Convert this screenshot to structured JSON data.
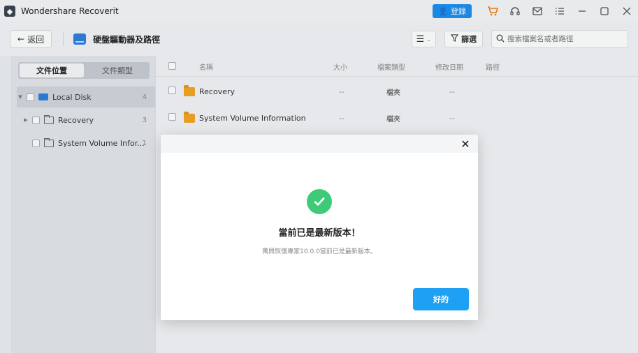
{
  "app": {
    "title": "Wondershare Recoverit"
  },
  "titlebar": {
    "login_label": "登錄"
  },
  "toolbar": {
    "back_label": "返回",
    "title": "硬盤驅動器及路徑",
    "filter_label": "篩選",
    "search_placeholder": "搜索檔案名或者路徑"
  },
  "sidebar": {
    "tabs": [
      {
        "label": "文件位置",
        "active": true
      },
      {
        "label": "文件類型",
        "active": false
      }
    ],
    "tree": [
      {
        "label": "Local Disk",
        "count": "4"
      },
      {
        "label": "Recovery",
        "count": "3"
      },
      {
        "label": "System Volume Infor...",
        "count": "1"
      }
    ]
  },
  "list": {
    "headers": {
      "name": "名稱",
      "size": "大小",
      "type": "檔案類型",
      "modified": "修改日期",
      "path": "路徑"
    },
    "rows": [
      {
        "name": "Recovery",
        "size": "--",
        "type": "檔夾",
        "modified": "--"
      },
      {
        "name": "System Volume Information",
        "size": "--",
        "type": "檔夾",
        "modified": "--"
      }
    ]
  },
  "dialog": {
    "title": "當前已是最新版本！",
    "message": "萬興恢復專家10.0.0當前已是最新版本。",
    "ok_label": "好的"
  },
  "colors": {
    "accent": "#1ea0f5",
    "success": "#3ecb78",
    "folder": "#f4a622"
  }
}
